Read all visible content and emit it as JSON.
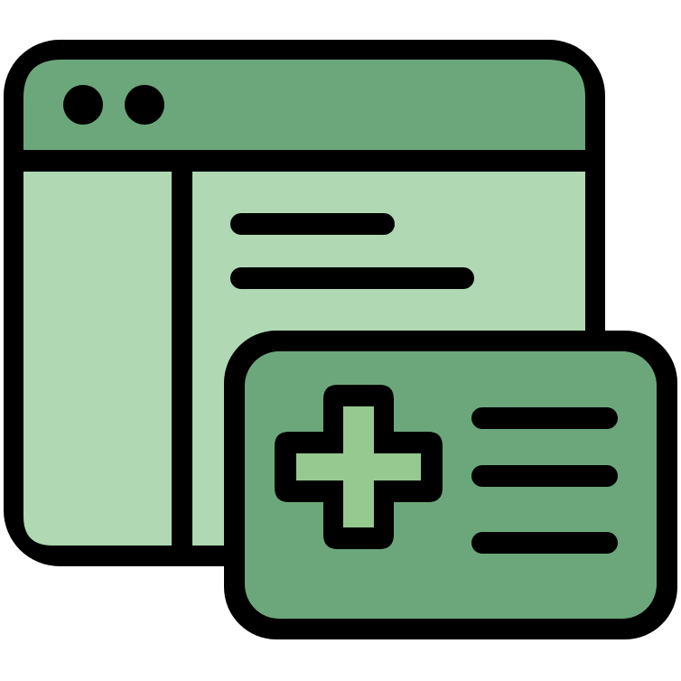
{
  "icon": {
    "name": "medical-web-page-icon"
  },
  "colors": {
    "outline": "#000000",
    "titlebar_fill": "#6ca77c",
    "content_fill": "#afd8b3",
    "sidebar_fill": "#afd8b3",
    "card_fill": "#6ca77c",
    "cross_fill": "#95c98f",
    "background": "#ffffff"
  }
}
